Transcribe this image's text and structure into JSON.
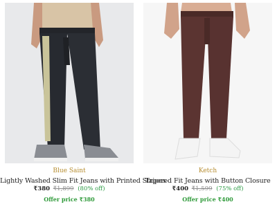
{
  "products": [
    {
      "image_alt": "Man wearing black jeans with printed stripe and grey sneakers",
      "brand": "Blue Saint",
      "title": "Lightly Washed Slim Fit Jeans with Printed Stripes",
      "price": "₹380",
      "mrp": "₹1,899",
      "discount": "(80% off)",
      "offer": "Offer price ₹380"
    },
    {
      "image_alt": "Man wearing maroon tapered jeans and white sneakers",
      "brand": "Ketch",
      "title": "Tapered Fit Jeans with Button Closure",
      "price": "₹400",
      "mrp": "₹1,599",
      "discount": "(75% off)",
      "offer": "Offer price ₹400"
    }
  ],
  "colors": {
    "brand": "#b58b2d",
    "offer": "#2f9a3a",
    "discount": "#2d9b45"
  }
}
